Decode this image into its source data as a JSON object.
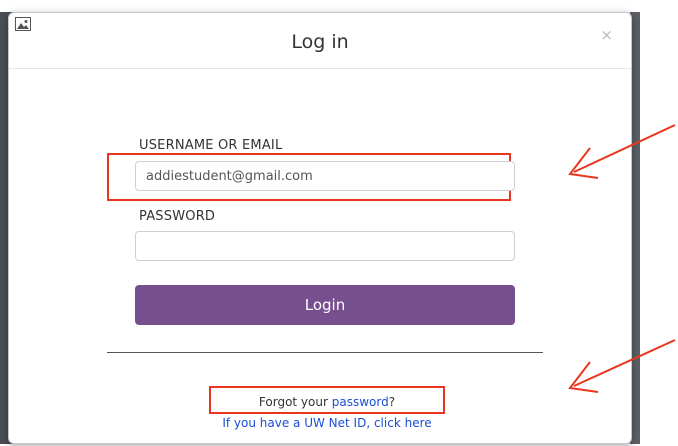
{
  "dialog": {
    "title": "Log in",
    "close_glyph": "×"
  },
  "form": {
    "username_label": "USERNAME OR EMAIL",
    "username_value": "addiestudent@gmail.com",
    "password_label": "PASSWORD",
    "password_value": "",
    "login_label": "Login"
  },
  "footer": {
    "forgot_prefix": "Forgot your ",
    "forgot_link": "password",
    "forgot_suffix": "?",
    "uw_link": "If you have a UW Net ID, click here"
  },
  "colors": {
    "login_button": "#774f8e",
    "annotation": "#e8371f",
    "link": "#1a4fd6"
  },
  "icons": {
    "corner": "image-icon",
    "close": "close-icon"
  }
}
